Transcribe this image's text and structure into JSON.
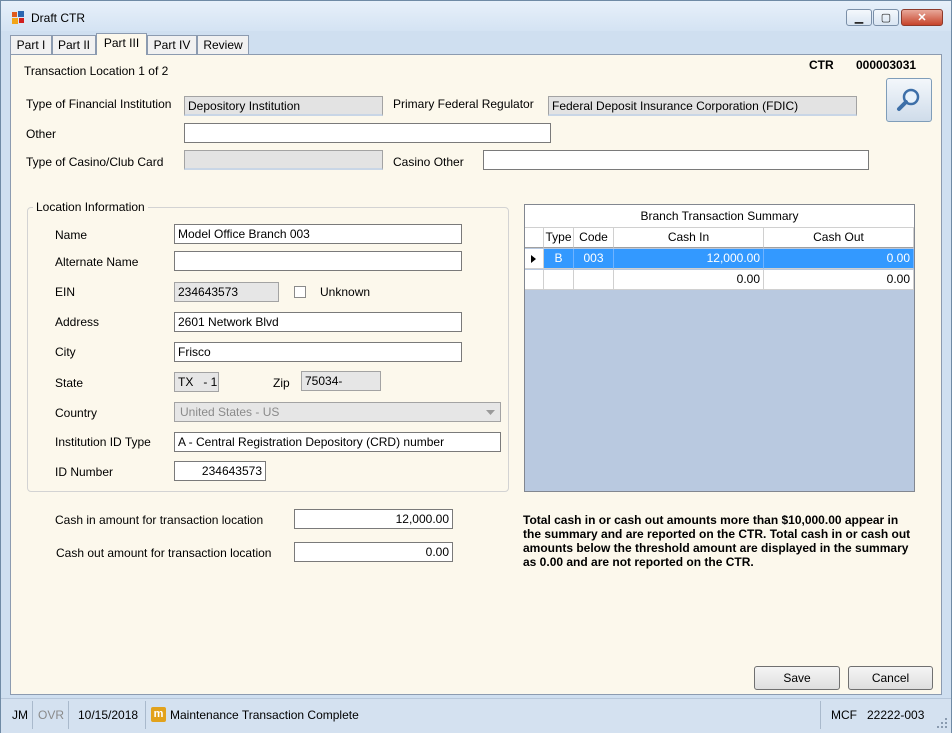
{
  "window": {
    "title": "Draft CTR",
    "controls": {
      "minimize": "▁",
      "maximize": "▢",
      "close": "✕"
    }
  },
  "tabs": [
    {
      "label": "Part I"
    },
    {
      "label": "Part II"
    },
    {
      "label": "Part III",
      "active": true
    },
    {
      "label": "Part IV"
    },
    {
      "label": "Review"
    }
  ],
  "header": {
    "location_text": "Transaction Location 1 of 2",
    "ctr_label": "CTR",
    "ctr_number": "000003031"
  },
  "institution": {
    "type_label": "Type of Financial Institution",
    "type_value": "Depository Institution",
    "regulator_label": "Primary Federal Regulator",
    "regulator_value": "Federal Deposit Insurance Corporation (FDIC)",
    "other_label": "Other",
    "other_value": "",
    "casino_card_label": "Type of Casino/Club Card",
    "casino_card_value": "",
    "casino_other_label": "Casino Other",
    "casino_other_value": ""
  },
  "search_icon": "magnifier-icon",
  "location": {
    "group_title": "Location Information",
    "name_label": "Name",
    "name_value": "Model Office Branch 003",
    "alt_name_label": "Alternate Name",
    "alt_name_value": "",
    "ein_label": "EIN",
    "ein_value": "234643573",
    "unknown_label": "Unknown",
    "unknown_checked": false,
    "address_label": "Address",
    "address_value": "2601 Network Blvd",
    "city_label": "City",
    "city_value": "Frisco",
    "state_label": "State",
    "state_value": "TX   - 1",
    "zip_label": "Zip",
    "zip_value": "75034-",
    "country_label": "Country",
    "country_value": "United States - US",
    "inst_id_type_label": "Institution ID Type",
    "inst_id_type_value": "A - Central Registration Depository (CRD) number",
    "id_number_label": "ID Number",
    "id_number_value": "234643573"
  },
  "cash": {
    "in_label": "Cash in amount for transaction location",
    "in_value": "12,000.00",
    "out_label": "Cash out amount for transaction location",
    "out_value": "0.00"
  },
  "summary_grid": {
    "caption": "Branch Transaction Summary",
    "columns": [
      "Type",
      "Code",
      "Cash In",
      "Cash Out"
    ],
    "rows": [
      {
        "type": "B",
        "code": "003",
        "cash_in": "12,000.00",
        "cash_out": "0.00",
        "selected": true
      },
      {
        "type": "",
        "code": "",
        "cash_in": "0.00",
        "cash_out": "0.00",
        "selected": false
      }
    ]
  },
  "note": "Total cash in or cash out amounts more than $10,000.00 appear in the summary and are reported on the CTR.  Total cash in or cash out amounts below the threshold amount are displayed in the summary as 0.00 and are not reported on the CTR.",
  "buttons": {
    "save": "Save",
    "cancel": "Cancel"
  },
  "statusbar": {
    "user": "JM",
    "ovr": "OVR",
    "date": "10/15/2018",
    "m_badge": "m",
    "message": "Maintenance Transaction Complete",
    "mcf": "MCF",
    "code": "22222-003"
  },
  "colors": {
    "selection": "#3399ff",
    "panel": "#fcf8ec",
    "grid_background": "#b9c9e0"
  }
}
